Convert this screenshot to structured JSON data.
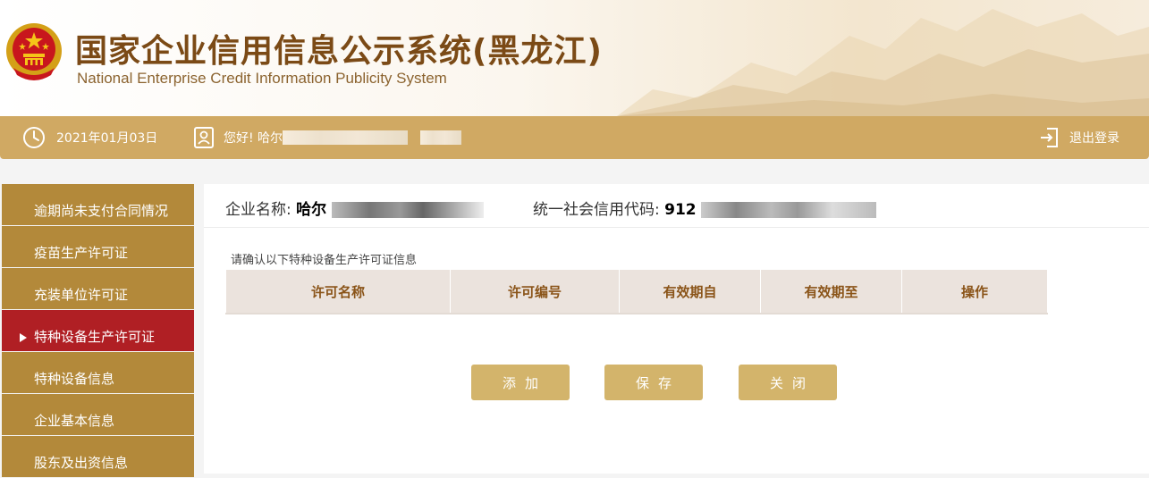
{
  "header": {
    "title_cn": "国家企业信用信息公示系统(黑龙江)",
    "title_en": "National Enterprise Credit Information Publicity System"
  },
  "topbar": {
    "date": "2021年01月03日",
    "greeting": "您好!  哈尔",
    "logout_label": "退出登录"
  },
  "sidebar": {
    "items": [
      {
        "label": "逾期尚未支付合同情况"
      },
      {
        "label": "疫苗生产许可证"
      },
      {
        "label": "充装单位许可证"
      },
      {
        "label": "特种设备生产许可证",
        "active": true
      },
      {
        "label": "特种设备信息"
      },
      {
        "label": "企业基本信息"
      },
      {
        "label": "股东及出资信息"
      }
    ]
  },
  "company": {
    "name_label": "企业名称:",
    "name_value": "哈尔",
    "code_label": "统一社会信用代码:",
    "code_value": "912"
  },
  "hint": "请确认以下特种设备生产许可证信息",
  "table": {
    "columns": [
      "许可名称",
      "许可编号",
      "有效期自",
      "有效期至",
      "操作"
    ]
  },
  "buttons": {
    "add": "添加",
    "save": "保存",
    "close": "关闭"
  },
  "colors": {
    "topbar": "#d0a963",
    "sidebar": "#b3893a",
    "sidebar_active": "#b01f24",
    "button": "#d3b46b",
    "title": "#7b4a16"
  }
}
